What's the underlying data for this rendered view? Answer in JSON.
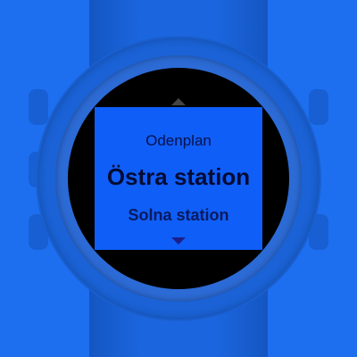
{
  "station_list": {
    "previous": "Odenplan",
    "current": "Östra station",
    "next": "Solna station"
  },
  "colors": {
    "background": "#1d6ff0",
    "screen": "#000000",
    "list_panel": "#0f5ef7",
    "text": "#07124a"
  },
  "icons": {
    "scroll_up": "triangle-up-icon",
    "scroll_down": "triangle-down-icon"
  }
}
